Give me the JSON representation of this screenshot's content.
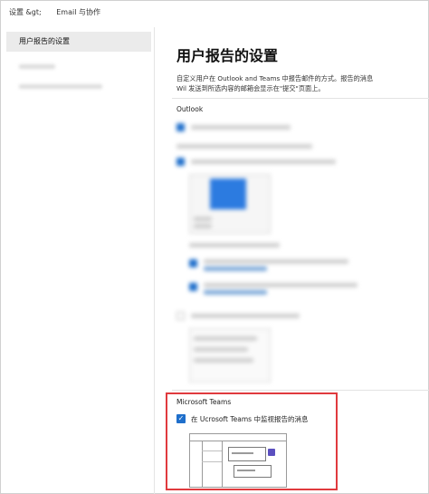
{
  "breadcrumb": {
    "home": "设置 &gt;",
    "current": "Email 与协作"
  },
  "sidebar": {
    "items": [
      {
        "label": "用户报告的设置",
        "active": true
      },
      {
        "label": "",
        "blurred": true
      },
      {
        "label": "",
        "blurred": true
      }
    ]
  },
  "main": {
    "title": "用户报告的设置",
    "description_lines": [
      "自定义用户在 Outlook and Teams 中报告邮件的方式。报告的消息",
      "Wil 发送到所选内容的邮箱会显示在\"提交\"页面上。"
    ],
    "outlook_label": "Outlook",
    "teams": {
      "label": "Microsoft Teams",
      "option_label": "在 Ucrosoft Teams 中监视报告的消息",
      "option_checked": true
    }
  },
  "colors": {
    "accent": "#1f6fcb",
    "highlight_border": "#e03a3e"
  },
  "icons": {
    "checkbox": "checkmark-icon",
    "teams_avatar": "teams-avatar-icon"
  }
}
